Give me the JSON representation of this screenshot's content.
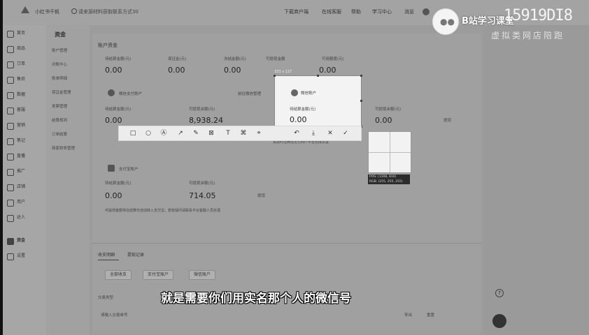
{
  "topbar": {
    "brand": "小红书千帆",
    "notice": "请来源材料获取联系方式30",
    "nav": [
      "下载商户端",
      "在线客服",
      "帮助",
      "学习中心",
      "消息"
    ]
  },
  "sidebar": {
    "items": [
      {
        "label": "首页"
      },
      {
        "label": "商品"
      },
      {
        "label": "订单"
      },
      {
        "label": "售后"
      },
      {
        "label": "数据"
      },
      {
        "label": "客服"
      },
      {
        "label": "营销"
      },
      {
        "label": "笔记"
      },
      {
        "label": "直播"
      },
      {
        "label": "推广"
      },
      {
        "label": "店铺"
      },
      {
        "label": "用户"
      },
      {
        "label": "达人"
      },
      {
        "label": "资金"
      },
      {
        "label": "设置"
      }
    ]
  },
  "subside": {
    "title": "资金",
    "items": [
      "账户管理",
      "对账中心",
      "账单明细",
      "保证金管理",
      "发票管理",
      "结算规则",
      "订单结算",
      "商家财务管理"
    ]
  },
  "main": {
    "section_title": "账户资金",
    "stats": [
      {
        "label": "待结算金额(元)",
        "value": "0.00"
      },
      {
        "label": "保证金(元)",
        "value": "0.00"
      },
      {
        "label": "冻结金额(元)",
        "value": "0.00"
      },
      {
        "label": "可提现金额",
        "value": "0.00"
      },
      {
        "label": "可用额度(元)",
        "value": "0.00"
      }
    ],
    "wechat_card": {
      "title": "微信支付账户",
      "link": "前往微信管理",
      "col1_label": "待结算金额(元)",
      "col1_value": "0.00",
      "col2_label": "可提现余额(元)",
      "col2_value": "8,938.24",
      "col3_label": "可提现余额(元)",
      "col3_value": "0.00",
      "withdraw": "提现",
      "note": "请及时在微信支付商户平台完成认证"
    },
    "alipay_card": {
      "title": "支付宝账户",
      "col1_label": "待结算金额(元)",
      "col1_value": "0.00",
      "col2_label": "可提现余额(元)",
      "col2_value": "714.05",
      "withdraw": "提现",
      "note": "可提现金额将在结算日自动转入支付宝，若有疑问请联系平台客服人员处理"
    },
    "tabs": [
      "收支明细",
      "提现记录"
    ],
    "filters": [
      "全部收支",
      "支付宝账户",
      "微信账户"
    ],
    "search_placeholder": "请输入交易单号",
    "filter_label": "交易类型",
    "export": "导出",
    "reset": "重置"
  },
  "screenshot": {
    "dimension_label": "333 x 127",
    "popup_title": "微信账户",
    "popup_label": "待结算金额(元)",
    "popup_value": "0.00",
    "tools": [
      "□",
      "○",
      "Ⓐ",
      "↗",
      "✎",
      "⊠",
      "T",
      "⌘",
      "⌖",
      "↶",
      "⤓",
      "✕",
      "✓"
    ],
    "magnifier_info": "POS: (1308, 816)\nRGB: (255, 255, 255)"
  },
  "watermark": {
    "title": "B站学习课堂",
    "number": "15919DI8",
    "subtitle": "虚拟类网店陪跑"
  },
  "subtitle": "就是需要你们用实名那个人的微信号"
}
